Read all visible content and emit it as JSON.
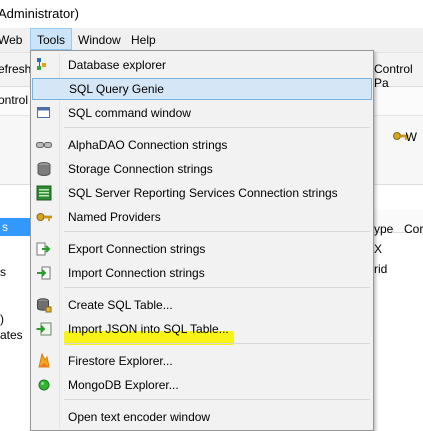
{
  "window": {
    "title": "Administrator)"
  },
  "menubar": {
    "web": "Web",
    "tools": "Tools",
    "window": "Window",
    "help": "Help"
  },
  "toolbar": {
    "refresh": "efresh",
    "control_panel": "Control Pa"
  },
  "strip": {
    "control_panel": "ontrol Pa"
  },
  "bigtoolbar": {
    "w": "W"
  },
  "leftpane": {
    "sel": "s",
    "r1": "s",
    "r2": ")",
    "r3": "ates"
  },
  "rightpane": {
    "col1": "ype",
    "col2": "Cor",
    "c1": "X",
    "c2": "rid"
  },
  "tools_menu": {
    "items": [
      {
        "label": "Database explorer",
        "icon": "database-explorer-icon"
      },
      {
        "label": "SQL Query Genie",
        "icon": "none",
        "highlighted": true
      },
      {
        "label": "SQL command window",
        "icon": "window-icon"
      },
      {
        "label": "AlphaDAO Connection strings",
        "icon": "connection-icon"
      },
      {
        "label": "Storage Connection strings",
        "icon": "storage-icon"
      },
      {
        "label": "SQL Server Reporting Services Connection strings",
        "icon": "report-icon"
      },
      {
        "label": "Named Providers",
        "icon": "key-icon"
      },
      {
        "label": "Export Connection strings",
        "icon": "export-icon"
      },
      {
        "label": "Import Connection strings",
        "icon": "import-icon"
      },
      {
        "label": "Create SQL Table...",
        "icon": "create-table-icon"
      },
      {
        "label": "Import JSON into SQL Table...",
        "icon": "import-json-icon"
      },
      {
        "label": "Firestore Explorer...",
        "icon": "firestore-icon"
      },
      {
        "label": "MongoDB Explorer...",
        "icon": "mongodb-icon"
      },
      {
        "label": "Open text encoder window",
        "icon": "none"
      }
    ]
  },
  "colors": {
    "highlight": "#d5e6f7",
    "annotation": "#f7f20a",
    "selection": "#3399ff"
  }
}
